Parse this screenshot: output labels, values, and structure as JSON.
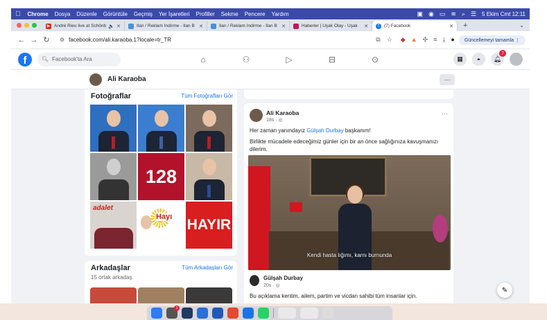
{
  "menubar": {
    "app": "Chrome",
    "items": [
      "Dosya",
      "Düzenle",
      "Görüntüle",
      "Geçmiş",
      "Yer İşaretleri",
      "Profiller",
      "Sekme",
      "Pencere",
      "Yardım"
    ],
    "datetime": "5 Ekim Cmt  12:11"
  },
  "tabs": [
    {
      "label": "André Rieu live at Schönb",
      "color": "#e62117"
    },
    {
      "label": "İlan / Reklam İndirme - İlan B",
      "color": "#4a90d9"
    },
    {
      "label": "İlan / Reklam İndirme - İlan B",
      "color": "#4a90d9"
    },
    {
      "label": "Haberler | Uşak Olay - Uşak",
      "color": "#c2185b"
    },
    {
      "label": "(7) Facebook",
      "color": "#1877f2"
    }
  ],
  "address": {
    "url": "facebook.com/ali.karaoba.1?locale=tr_TR",
    "update_label": "Güncellemeyi tamamla"
  },
  "fb": {
    "logo": "f",
    "search_placeholder": "Facebook'ta Ara",
    "notif_count": "7"
  },
  "profile": {
    "name": "Ali Karaoba"
  },
  "photos_card": {
    "title": "Fotoğraflar",
    "link": "Tüm Fotoğrafları Gör",
    "tile_128": "128",
    "tile_hayir": "HAYIR",
    "tile_adalet": "adalet",
    "tile_hayi": "Hayı"
  },
  "friends_card": {
    "title": "Arkadaşlar",
    "link": "Tüm Arkadaşları Gör",
    "subtitle": "15 ortak arkadaş"
  },
  "post": {
    "author": "Ali Karaoba",
    "meta": "18s · ◎",
    "text_before": "Her zaman yanındayız ",
    "mention": "Gülşah Durbay",
    "text_after": "  başkanım!",
    "text2": "Birlikte mücadele edeceğimiz günler için bir an önce sağlığınıza kavuşmanızı dilerim.",
    "video_subtitle": "Kendi hasta lığımı, karnı burnunda",
    "shared_name": "Gülşah Durbay",
    "shared_meta": "20s · ◎",
    "shared_text": "Bu açıklama kentim, ailem, partim ve vicdan sahibi tüm insanlar için."
  },
  "dock": {
    "badge": "1",
    "colors": [
      "#2d7cf6",
      "#555555",
      "#1e3a5f",
      "#2b6fd6",
      "#2259b8",
      "#e34a2f",
      "#1a73e8",
      "#25d366"
    ]
  }
}
